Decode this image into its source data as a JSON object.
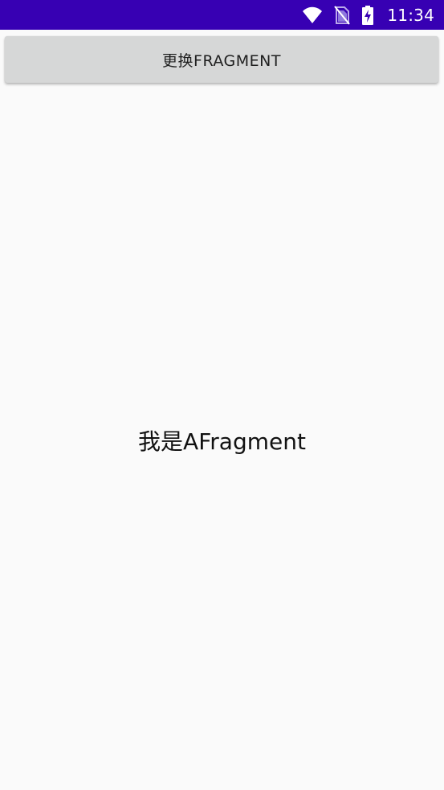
{
  "status_bar": {
    "time": "11:34",
    "background_color": "#3700b3",
    "icons": [
      "wifi-icon",
      "no-sim-icon",
      "battery-charging-icon"
    ]
  },
  "switch_button": {
    "label": "更换FRAGMENT",
    "background_color": "#d6d7d7"
  },
  "fragment": {
    "text": "我是AFragment"
  },
  "colors": {
    "page_background": "#fafafa"
  }
}
